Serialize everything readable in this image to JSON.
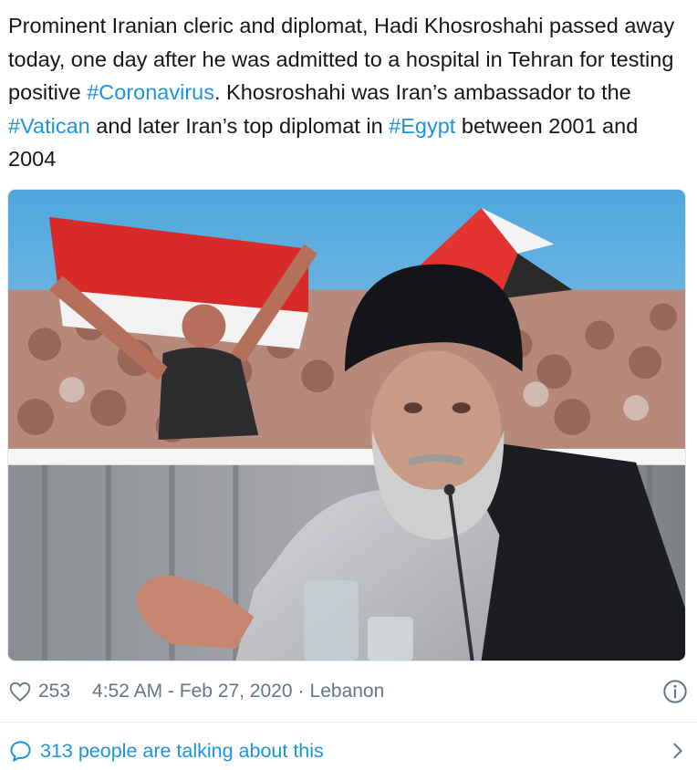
{
  "tweet": {
    "text_parts": [
      {
        "text": "Prominent Iranian cleric and diplomat, Hadi Khosroshahi passed away today, one day after he was admitted to a hospital in Tehran for testing positive ",
        "hashtag": false
      },
      {
        "text": "#Coronavirus",
        "hashtag": true
      },
      {
        "text": ". Khosroshahi was Iran’s ambassador to the ",
        "hashtag": false
      },
      {
        "text": "#Vatican",
        "hashtag": true
      },
      {
        "text": " and later Iran’s top diplomat in ",
        "hashtag": false
      },
      {
        "text": "#Egypt",
        "hashtag": true
      },
      {
        "text": " between 2001 and 2004",
        "hashtag": false
      }
    ]
  },
  "media": {
    "kind": "photo"
  },
  "meta": {
    "like_count": "253",
    "timestamp": "4:52 AM - Feb 27, 2020",
    "separator": "·",
    "location": "Lebanon",
    "like_icon": "heart-outline-icon",
    "info_icon": "info-circle-icon"
  },
  "conversation": {
    "label": "313 people are talking about this",
    "icon": "speech-bubble-icon",
    "chevron": "chevron-right-icon"
  },
  "colors": {
    "text": "#14171a",
    "link": "#1b95e0",
    "muted": "#657786",
    "divider": "#e6ecf0"
  }
}
